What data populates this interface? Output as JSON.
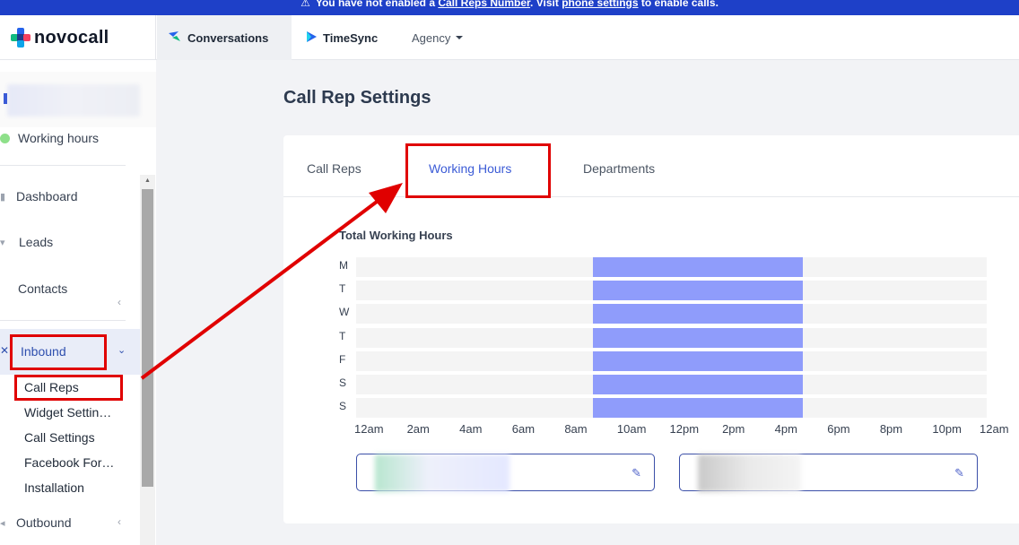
{
  "banner": {
    "text_before": "You have not enabled a ",
    "link1": "Call Reps Number",
    "text_mid": ". Visit ",
    "link2": "phone settings",
    "text_after": " to enable calls."
  },
  "topbar": {
    "logo": "novocall",
    "nav": [
      {
        "label": "Conversations",
        "icon": "conversations-icon"
      },
      {
        "label": "TimeSync",
        "icon": "timesync-icon"
      },
      {
        "label": "Agency",
        "icon": "caret-down-icon"
      }
    ]
  },
  "sidebar": {
    "status_label": "Working hours",
    "items": [
      {
        "label": "Dashboard",
        "icon": "bar-chart-icon"
      },
      {
        "label": "Leads",
        "icon": "funnel-icon"
      },
      {
        "label": "Contacts",
        "icon": "contacts-icon"
      },
      {
        "label": "Inbound",
        "icon": "inbound-icon"
      },
      {
        "label": "Outbound",
        "icon": "outbound-icon"
      }
    ],
    "inbound_sub": [
      "Call Reps",
      "Widget Settin…",
      "Call Settings",
      "Facebook For…",
      "Installation"
    ]
  },
  "page": {
    "title": "Call Rep Settings",
    "tabs": [
      "Call Reps",
      "Working Hours",
      "Departments"
    ],
    "active_tab": "Working Hours"
  },
  "chart": {
    "title": "Total Working Hours",
    "days": [
      "M",
      "T",
      "W",
      "T",
      "F",
      "S",
      "S"
    ],
    "hours": [
      "12am",
      "2am",
      "4am",
      "6am",
      "8am",
      "10am",
      "12pm",
      "2pm",
      "4pm",
      "6pm",
      "8pm",
      "10pm",
      "12am"
    ],
    "accent": "#8f9cfb"
  },
  "chart_data": {
    "type": "heatmap",
    "title": "Total Working Hours",
    "rows": [
      "M",
      "T",
      "W",
      "T",
      "F",
      "S",
      "S"
    ],
    "x_ticks": [
      "12am",
      "2am",
      "4am",
      "6am",
      "8am",
      "10am",
      "12pm",
      "2pm",
      "4pm",
      "6pm",
      "8pm",
      "10pm",
      "12am"
    ],
    "xlim": [
      0,
      24
    ],
    "working_start_hour": 9,
    "working_end_hour": 17
  },
  "colors": {
    "accent_blue": "#3b5bd6",
    "highlight_red": "#e00000",
    "banner_blue": "#1e40c8"
  }
}
